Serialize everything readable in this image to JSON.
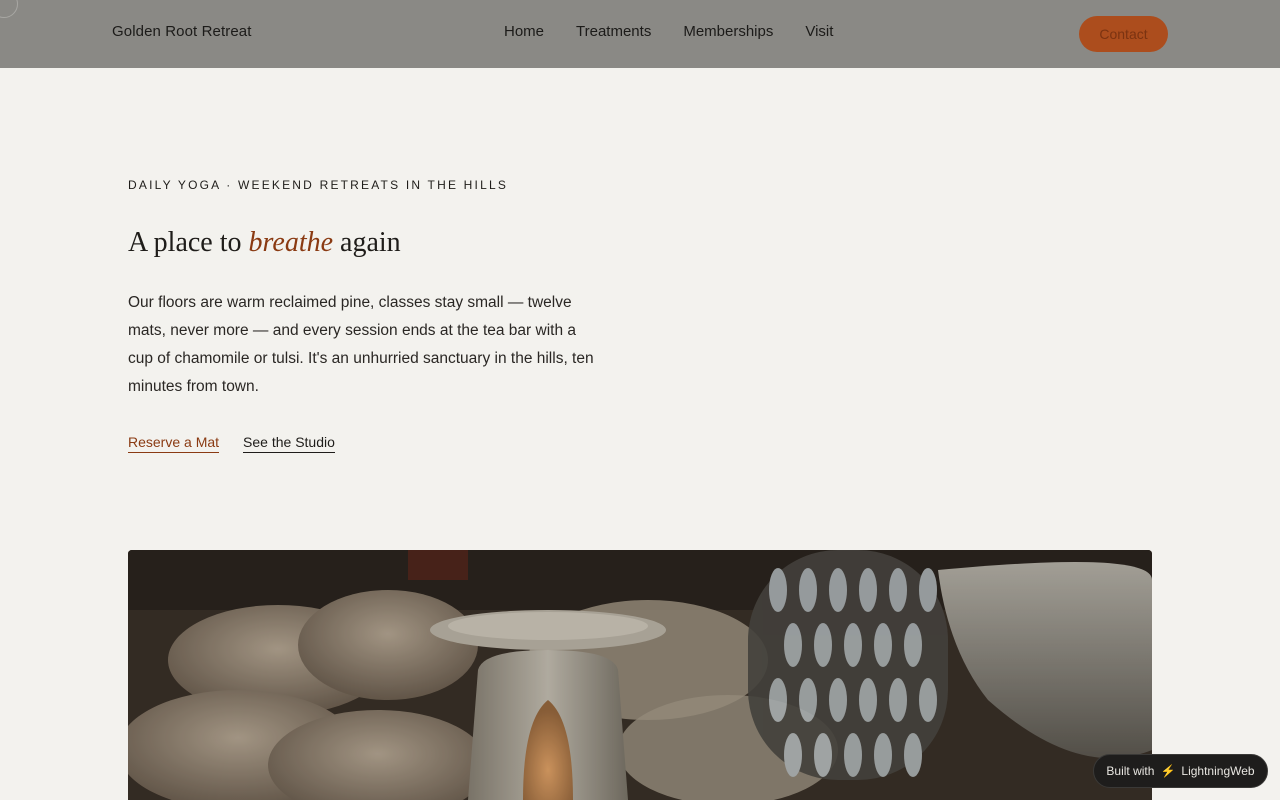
{
  "header": {
    "brand": "Golden Root Retreat",
    "nav": [
      "Home",
      "Treatments",
      "Memberships",
      "Visit"
    ],
    "contact_label": "Contact"
  },
  "hero": {
    "eyebrow": "DAILY YOGA · WEEKEND RETREATS IN THE HILLS",
    "headline_before": "A place to ",
    "headline_accent": "breathe",
    "headline_after": " again",
    "body": "Our floors are warm reclaimed pine, classes stay small — twelve mats, never more — and every session ends at the tea bar with a cup of chamomile or tulsi. It's an unhurried sanctuary in the hills, ten minutes from town.",
    "primary_cta": "Reserve a Mat",
    "secondary_cta": "See the Studio"
  },
  "badge": {
    "prefix": "Built with",
    "icon": "lightning-icon",
    "name": "LightningWeb"
  },
  "colors": {
    "accent": "#ac4d1d",
    "accent_text": "#8a3a12",
    "header_bg": "#8a8985",
    "page_bg": "#f3f2ee"
  }
}
